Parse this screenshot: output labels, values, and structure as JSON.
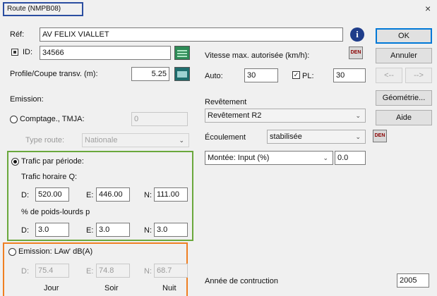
{
  "title": "Route (NMPB08)",
  "close_glyph": "×",
  "ref": {
    "label": "Réf:",
    "value": "AV FELIX VIALLET"
  },
  "id": {
    "label": "ID:",
    "value": "34566"
  },
  "profile": {
    "label": "Profile/Coupe transv. (m):",
    "value": "5.25"
  },
  "emission_heading": "Emission:",
  "comptage": {
    "label": "Comptage., TMJA:",
    "value": "0"
  },
  "type_route": {
    "label": "Type route:",
    "value": "Nationale"
  },
  "trafic": {
    "label": "Trafic par période:",
    "horaire_label": "Trafic horaire Q:",
    "d_label": "D:",
    "d_value": "520.00",
    "e_label": "E:",
    "e_value": "446.00",
    "n_label": "N:",
    "n_value": "111.00",
    "pl_label": "% de poids-lourds p",
    "pd_value": "3.0",
    "pe_value": "3.0",
    "pn_value": "3.0"
  },
  "emission_law": {
    "label": "Emission: LAw' dB(A)",
    "d_label": "D:",
    "d_value": "75.4",
    "e_label": "E:",
    "e_value": "74.8",
    "n_label": "N:",
    "n_value": "68.7",
    "jour": "Jour",
    "soir": "Soir",
    "nuit": "Nuit"
  },
  "vitesse": {
    "label": "Vitesse max. autorisée (km/h):",
    "auto_label": "Auto:",
    "auto_value": "30",
    "pl_label": "PL:",
    "pl_value": "30"
  },
  "revetement": {
    "label": "Revêtement",
    "value": "Revêtement R2"
  },
  "ecoulement": {
    "label": "Écoulement",
    "value": "stabilisée"
  },
  "montee": {
    "value": "Montée: Input (%)",
    "input": "0.0"
  },
  "annee": {
    "label": "Année de contruction",
    "value": "2005"
  },
  "buttons": {
    "ok": "OK",
    "annuler": "Annuler",
    "back": "<--",
    "fwd": "-->",
    "geometrie": "Géométrie...",
    "aide": "Aide",
    "den": "DEN"
  },
  "colors": {
    "title_highlight": "#2b4ea0",
    "trafic_highlight": "#6aa83c",
    "emission_highlight": "#ef7f22"
  }
}
